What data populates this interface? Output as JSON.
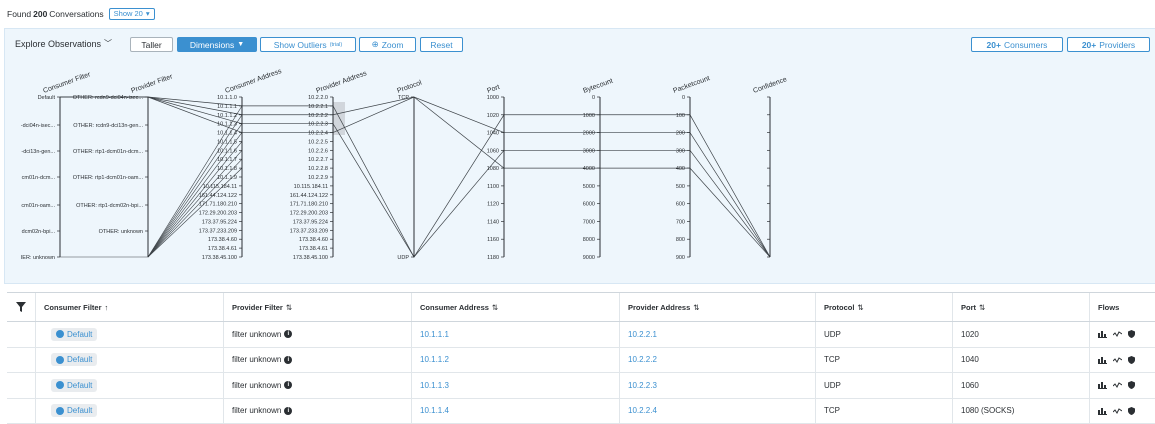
{
  "header": {
    "found_prefix": "Found",
    "count": "200",
    "found_suffix": "Conversations",
    "show_label": "Show 20"
  },
  "toolbar": {
    "explore_label": "Explore Observations",
    "taller_label": "Taller",
    "dimensions_label": "Dimensions",
    "outliers_label": "Show Outliers",
    "outliers_sup": "(trial)",
    "zoom_label": "Zoom",
    "reset_label": "Reset",
    "consumers_count": "20+",
    "consumers_label": "Consumers",
    "providers_count": "20+",
    "providers_label": "Providers"
  },
  "axes": [
    {
      "title": "Consumer Filter",
      "ticks": [
        "Default",
        "-dci04n-isec...",
        "-dci13n-gen...",
        "cm01n-dcm...",
        "cm01n-oam...",
        "dcm02n-bpi...",
        "IER: unknown"
      ]
    },
    {
      "title": "Provider Filter",
      "ticks": [
        "OTHER: rcdn9-dci04n-isec...",
        "OTHER: rcdn9-dci13n-gen...",
        "OTHER: rtp1-dcm01n-dcm...",
        "OTHER: rtp1-dcm01n-oam...",
        "OTHER: rtp1-dcm02n-bpi...",
        "OTHER: unknown"
      ]
    },
    {
      "title": "Consumer Address",
      "ticks": [
        "10.1.1.0",
        "10.1.1.1",
        "10.1.1.2",
        "10.1.1.3",
        "10.1.1.4",
        "10.1.1.5",
        "10.1.1.6",
        "10.1.1.7",
        "10.1.1.8",
        "10.1.1.9",
        "10.115.184.11",
        "161.44.124.122",
        "171.71.180.210",
        "172.29.200.203",
        "173.37.95.224",
        "173.37.233.209",
        "173.38.4.60",
        "173.38.4.61",
        "173.38.45.100"
      ]
    },
    {
      "title": "Provider Address",
      "ticks": [
        "10.2.2.0",
        "10.2.2.1",
        "10.2.2.2",
        "10.2.2.3",
        "10.2.2.4",
        "10.2.2.5",
        "10.2.2.6",
        "10.2.2.7",
        "10.2.2.8",
        "10.2.2.9",
        "10.115.184.11",
        "161.44.124.122",
        "171.71.180.210",
        "172.29.200.203",
        "173.37.95.224",
        "173.37.233.209",
        "173.38.4.60",
        "173.38.4.61",
        "173.38.45.100"
      ]
    },
    {
      "title": "Protocol",
      "ticks": [
        "TCP",
        "UDP"
      ]
    },
    {
      "title": "Port",
      "ticks": [
        "1000",
        "1020",
        "1040",
        "1060",
        "1080",
        "1100",
        "1120",
        "1140",
        "1160",
        "1180"
      ]
    },
    {
      "title": "Bytecount",
      "ticks": [
        "0",
        "1000",
        "2000",
        "3000",
        "4000",
        "5000",
        "6000",
        "7000",
        "8000",
        "9000"
      ]
    },
    {
      "title": "Packetcount",
      "ticks": [
        "0",
        "100",
        "200",
        "300",
        "400",
        "500",
        "600",
        "700",
        "800",
        "900"
      ]
    },
    {
      "title": "Confidence",
      "ticks": []
    }
  ],
  "table": {
    "columns": [
      "Consumer Filter",
      "Provider Filter",
      "Consumer Address",
      "Provider Address",
      "Protocol",
      "Port",
      "Flows"
    ],
    "sort_asc": "↑",
    "sort_both": "⇅",
    "rows": [
      {
        "consumer_filter": "Default",
        "provider_filter": "filter unknown",
        "consumer_address": "10.1.1.1",
        "provider_address": "10.2.2.1",
        "protocol": "UDP",
        "port": "1020"
      },
      {
        "consumer_filter": "Default",
        "provider_filter": "filter unknown",
        "consumer_address": "10.1.1.2",
        "provider_address": "10.2.2.2",
        "protocol": "TCP",
        "port": "1040"
      },
      {
        "consumer_filter": "Default",
        "provider_filter": "filter unknown",
        "consumer_address": "10.1.1.3",
        "provider_address": "10.2.2.3",
        "protocol": "UDP",
        "port": "1060"
      },
      {
        "consumer_filter": "Default",
        "provider_filter": "filter unknown",
        "consumer_address": "10.1.1.4",
        "provider_address": "10.2.2.4",
        "protocol": "TCP",
        "port": "1080 (SOCKS)"
      }
    ]
  },
  "colors": {
    "accent": "#3b90d0",
    "panel_bg": "#eef6fc"
  }
}
